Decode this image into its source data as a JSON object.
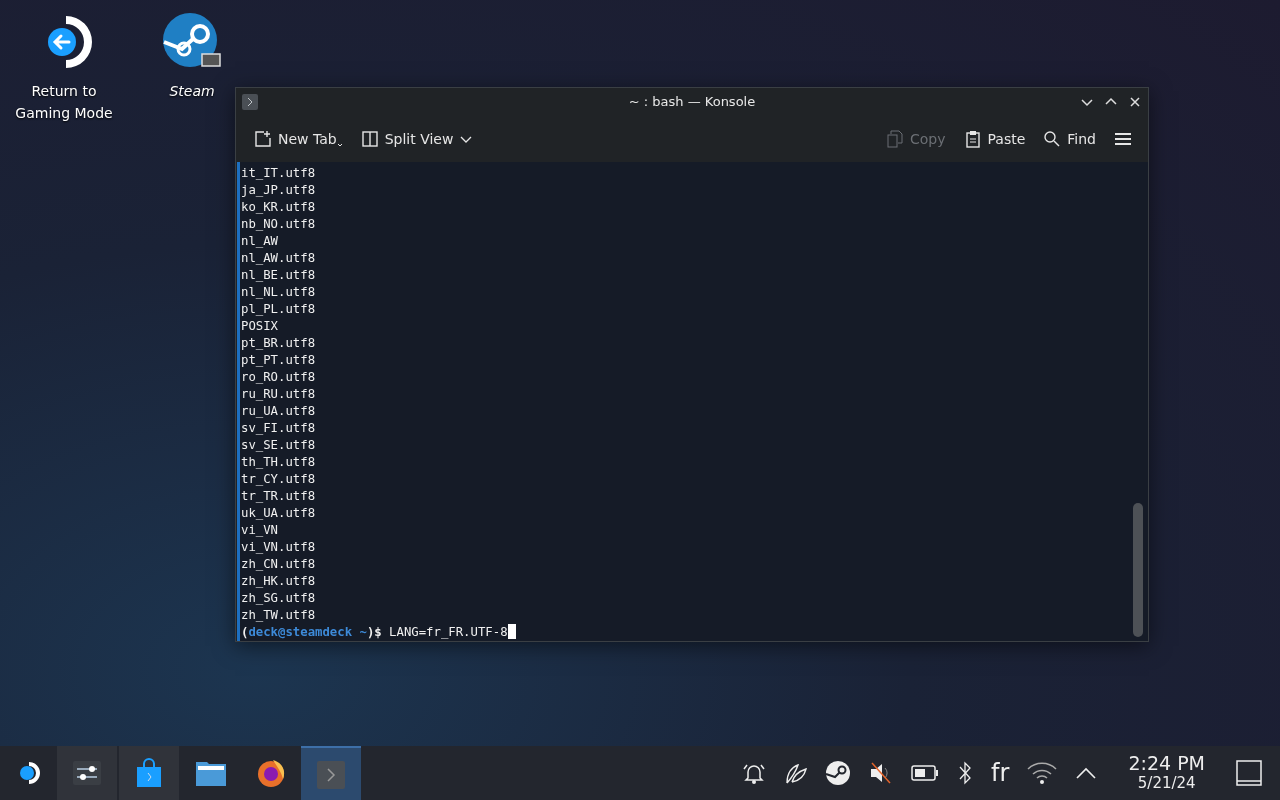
{
  "desktop_icons": [
    {
      "kind": "return",
      "label": "Return to Gaming Mode"
    },
    {
      "kind": "steam",
      "label": "Steam"
    }
  ],
  "window": {
    "title": "~ : bash — Konsole",
    "toolbar": [
      {
        "kind": "new-tab",
        "label": "New Tab",
        "disabled": false
      },
      {
        "kind": "split",
        "label": "Split View",
        "disabled": false
      },
      {
        "kind": "copy",
        "label": "Copy",
        "disabled": true
      },
      {
        "kind": "paste",
        "label": "Paste",
        "disabled": false
      },
      {
        "kind": "find",
        "label": "Find",
        "disabled": false
      },
      {
        "kind": "menu",
        "disabled": false
      }
    ],
    "terminal": {
      "lines": [
        "it_IT.utf8",
        "ja_JP.utf8",
        "ko_KR.utf8",
        "nb_NO.utf8",
        "nl_AW",
        "nl_AW.utf8",
        "nl_BE.utf8",
        "nl_NL.utf8",
        "pl_PL.utf8",
        "POSIX",
        "pt_BR.utf8",
        "pt_PT.utf8",
        "ro_RO.utf8",
        "ru_RU.utf8",
        "ru_UA.utf8",
        "sv_FI.utf8",
        "sv_SE.utf8",
        "th_TH.utf8",
        "tr_CY.utf8",
        "tr_TR.utf8",
        "uk_UA.utf8",
        "vi_VN",
        "vi_VN.utf8",
        "zh_CN.utf8",
        "zh_HK.utf8",
        "zh_SG.utf8",
        "zh_TW.utf8"
      ],
      "prompt": {
        "open": "(",
        "user": "deck@steamdeck",
        "dir": "~",
        "close": ")$",
        "command": "LANG=fr_FR.UTF-8"
      }
    }
  },
  "taskbar": {
    "apps": [
      {
        "kind": "settings",
        "selected": false
      },
      {
        "kind": "store",
        "selected": false
      },
      {
        "kind": "files",
        "selected": false
      },
      {
        "kind": "browser",
        "selected": false
      },
      {
        "kind": "terminal",
        "selected": true
      }
    ],
    "language": "fr",
    "time": "2:24 PM",
    "date": "5/21/24"
  }
}
